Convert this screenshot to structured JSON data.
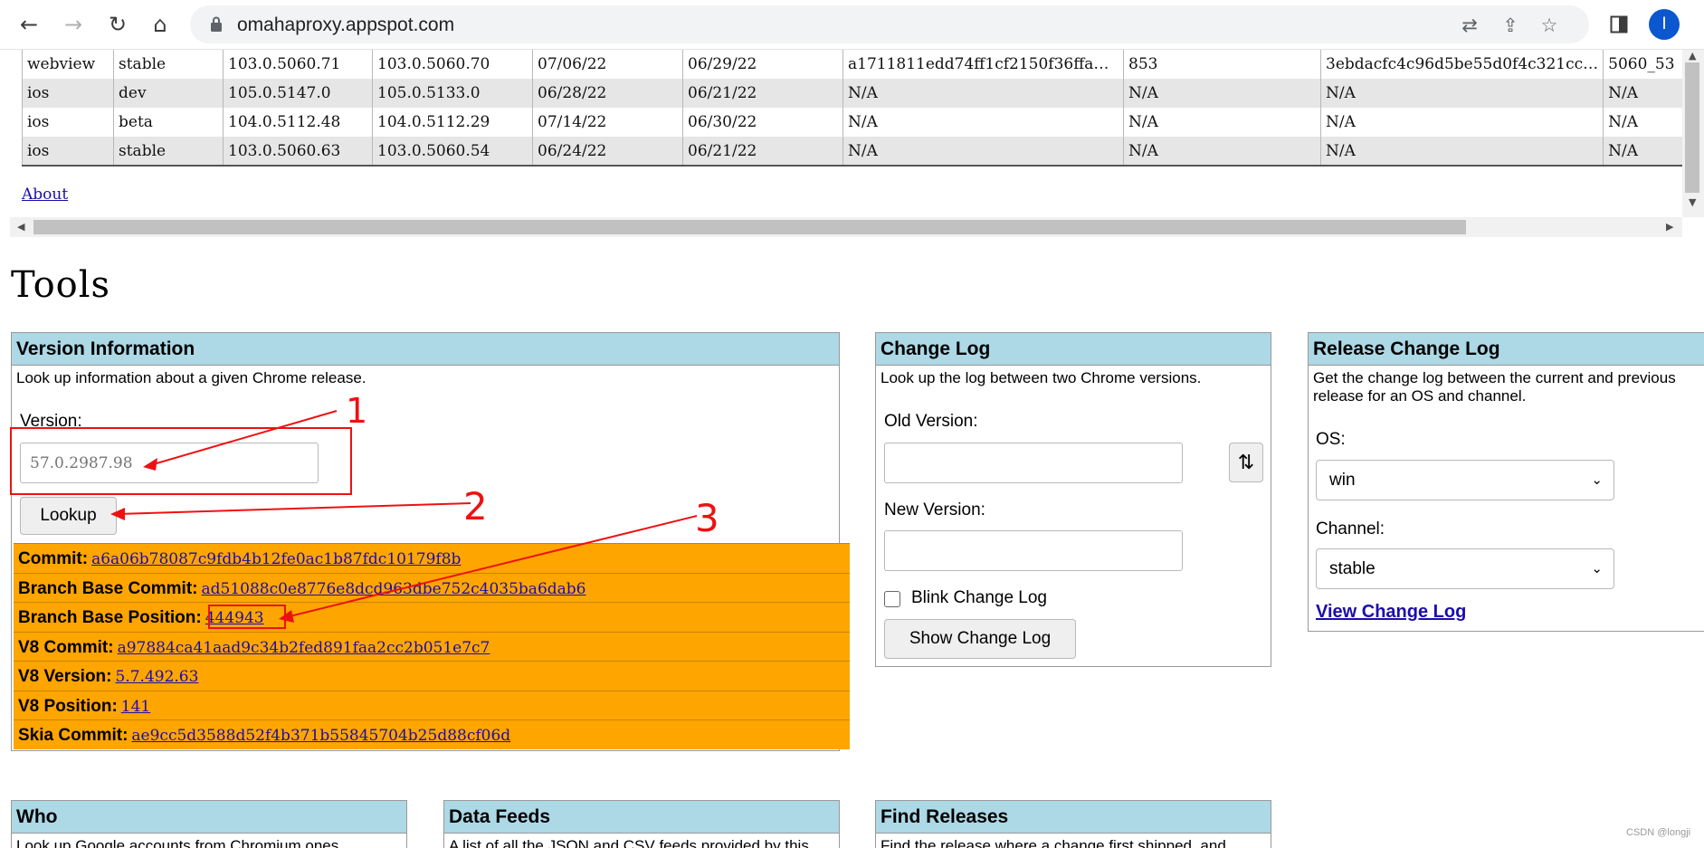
{
  "browser": {
    "url": "omahaproxy.appspot.com",
    "avatar_letter": "I"
  },
  "releases_table": {
    "rows": [
      [
        "webview",
        "stable",
        "103.0.5060.71",
        "103.0.5060.70",
        "07/06/22",
        "06/29/22",
        "a1711811edd74ff1cf2150f36ffa…",
        "853",
        "3ebdacfc4c96d5be55d0f4c321cc…",
        "5060_53"
      ],
      [
        "ios",
        "dev",
        "105.0.5147.0",
        "105.0.5133.0",
        "06/28/22",
        "06/21/22",
        "N/A",
        "N/A",
        "N/A",
        "N/A"
      ],
      [
        "ios",
        "beta",
        "104.0.5112.48",
        "104.0.5112.29",
        "07/14/22",
        "06/30/22",
        "N/A",
        "N/A",
        "N/A",
        "N/A"
      ],
      [
        "ios",
        "stable",
        "103.0.5060.63",
        "103.0.5060.54",
        "06/24/22",
        "06/21/22",
        "N/A",
        "N/A",
        "N/A",
        "N/A"
      ]
    ],
    "about_link": "About"
  },
  "tools_heading": "Tools",
  "version_info": {
    "title": "Version Information",
    "description": "Look up information about a given Chrome release.",
    "version_label": "Version:",
    "version_placeholder": "57.0.2987.98",
    "lookup_button": "Lookup",
    "results": [
      {
        "label": "Commit:",
        "value": "a6a06b78087c9fdb4b12fe0ac1b87fdc10179f8b"
      },
      {
        "label": "Branch Base Commit:",
        "value": "ad51088c0e8776e8dcd963dbe752c4035ba6dab6"
      },
      {
        "label": "Branch Base Position:",
        "value": "444943"
      },
      {
        "label": "V8 Commit:",
        "value": "a97884ca41aad9c34b2fed891faa2cc2b051e7c7"
      },
      {
        "label": "V8 Version:",
        "value": "5.7.492.63"
      },
      {
        "label": "V8 Position:",
        "value": "141"
      },
      {
        "label": "Skia Commit:",
        "value": "ae9cc5d3588d52f4b371b55845704b25d88cf06d"
      }
    ]
  },
  "change_log": {
    "title": "Change Log",
    "description": "Look up the log between two Chrome versions.",
    "old_version_label": "Old Version:",
    "new_version_label": "New Version:",
    "swap_icon": "swap-vertical-icon",
    "blink_label": "Blink Change Log",
    "show_button": "Show Change Log"
  },
  "release_change_log": {
    "title": "Release Change Log",
    "description": "Get the change log between the current and previous release for an OS and channel.",
    "os_label": "OS:",
    "os_value": "win",
    "channel_label": "Channel:",
    "channel_value": "stable",
    "view_link": "View Change Log"
  },
  "bottom_panels": [
    {
      "title": "Who",
      "description": "Look up Google accounts from Chromium ones."
    },
    {
      "title": "Data Feeds",
      "description": "A list of all the JSON and CSV feeds provided by this"
    },
    {
      "title": "Find Releases",
      "description": "Find the release where a change first shipped, and"
    }
  ],
  "annotations": [
    "1",
    "2",
    "3"
  ],
  "annotation_color": "#ee1111",
  "watermark": "CSDN @longji"
}
